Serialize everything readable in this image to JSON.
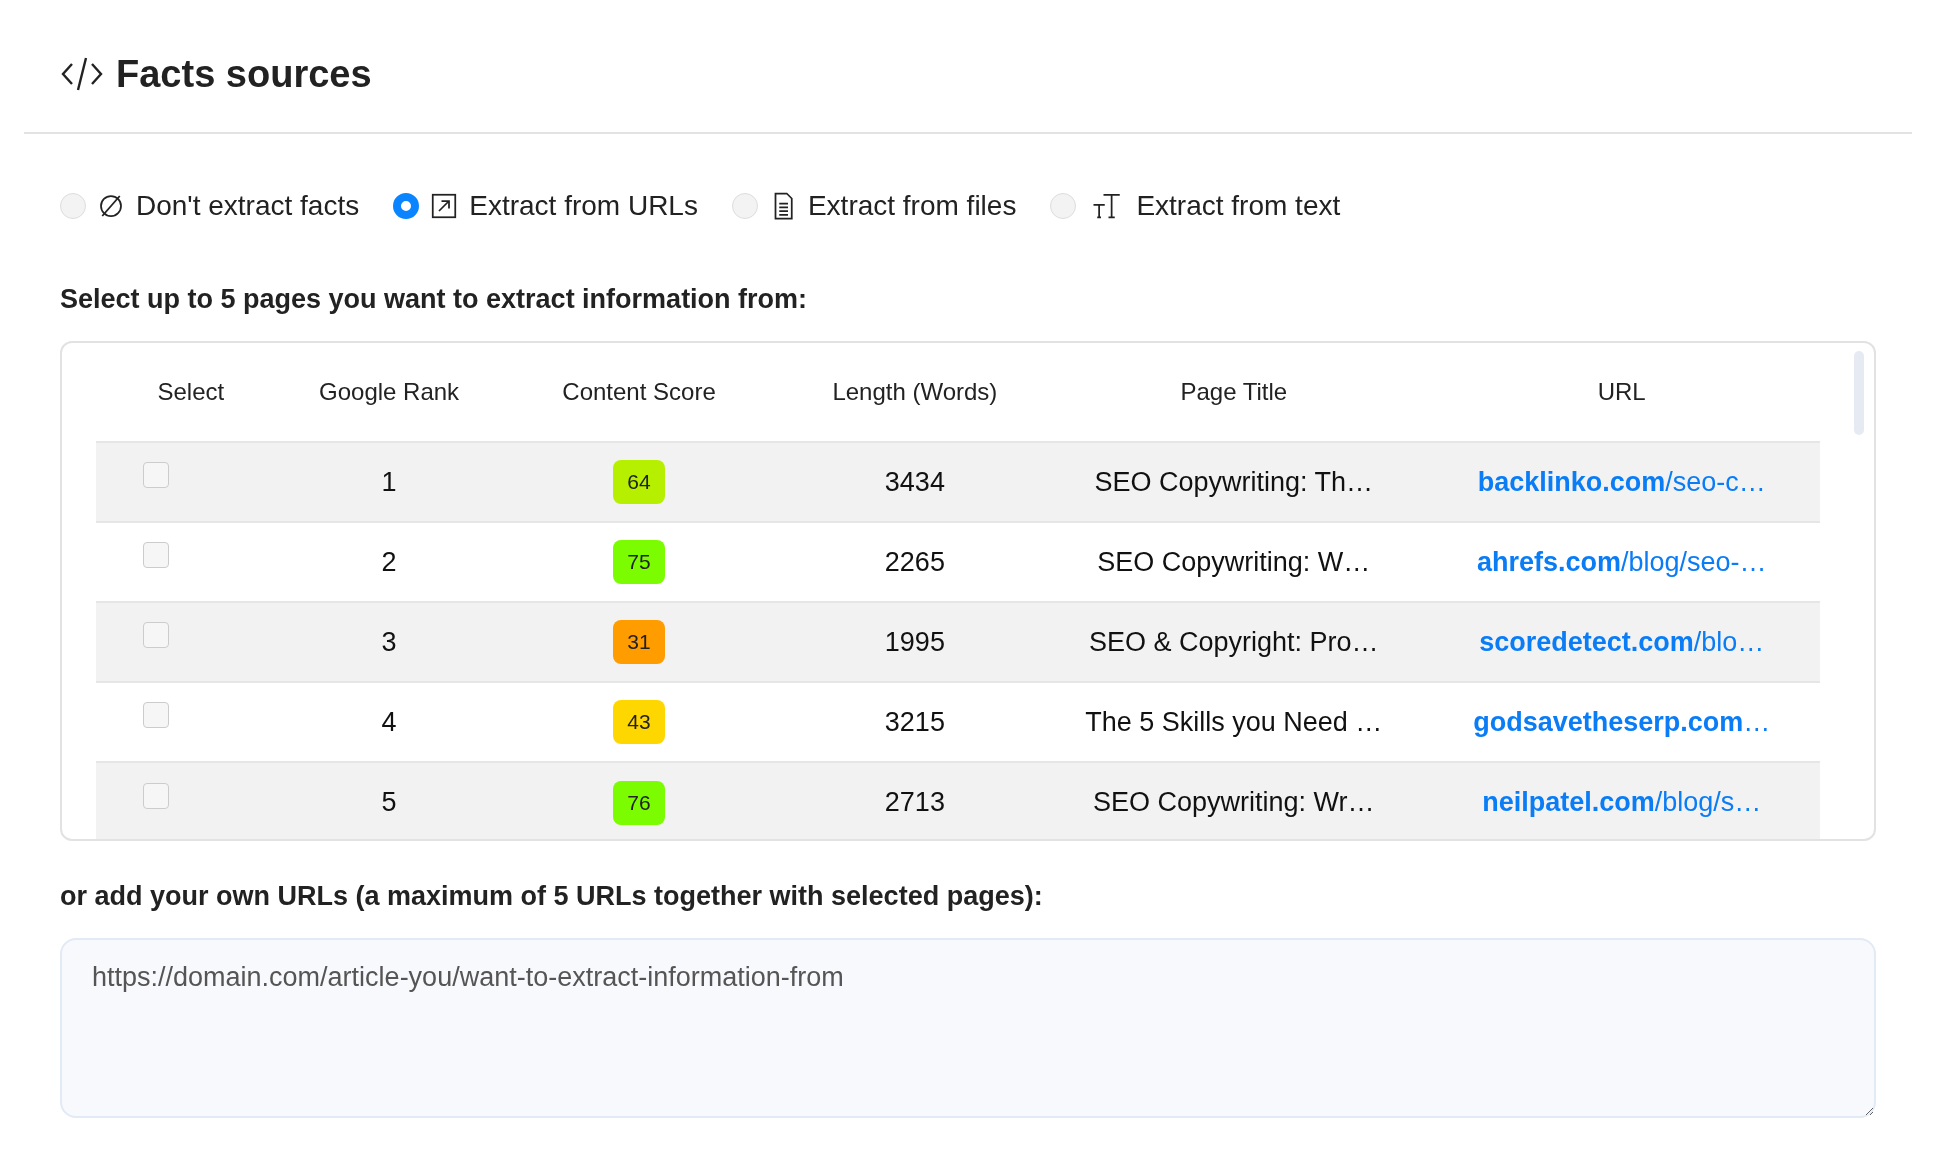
{
  "title": "Facts sources",
  "options": [
    {
      "label": "Don't extract facts",
      "kind": "none",
      "selected": false
    },
    {
      "label": "Extract from URLs",
      "kind": "urls",
      "selected": true
    },
    {
      "label": "Extract from files",
      "kind": "files",
      "selected": false
    },
    {
      "label": "Extract from text",
      "kind": "text",
      "selected": false
    }
  ],
  "pages_label": "Select up to 5 pages you want to extract information from:",
  "table": {
    "columns": [
      "Select",
      "Google Rank",
      "Content Score",
      "Length (Words)",
      "Page Title",
      "URL"
    ],
    "rows": [
      {
        "checked": false,
        "rank": "1",
        "score": "64",
        "color": "#b6f000",
        "length": "3434",
        "title": "SEO Copywriting: Th…",
        "url": "**backlinko.com**/seo-c…"
      },
      {
        "checked": false,
        "rank": "2",
        "score": "75",
        "color": "#7cfc00",
        "length": "2265",
        "title": "SEO Copywriting: W…",
        "url": "**ahrefs.com**/blog/seo-…"
      },
      {
        "checked": false,
        "rank": "3",
        "score": "31",
        "color": "#ff9c00",
        "length": "1995",
        "title": "SEO & Copyright: Pro…",
        "url": "**scoredetect.com**/blo…"
      },
      {
        "checked": false,
        "rank": "4",
        "score": "43",
        "color": "#ffd700",
        "length": "3215",
        "title": "The 5 Skills you Need …",
        "url": "**godsavetheserp.com**…"
      },
      {
        "checked": false,
        "rank": "5",
        "score": "76",
        "color": "#7cfc00",
        "length": "2713",
        "title": "SEO Copywriting: Wr…",
        "url": "**neilpatel.com**/blog/s…"
      }
    ]
  },
  "own_label": "or add your own URLs (a maximum of 5 URLs together with selected pages):",
  "urls_field": {
    "placeholder": "https://domain.com/article-you/want-to-extract-information-from"
  }
}
